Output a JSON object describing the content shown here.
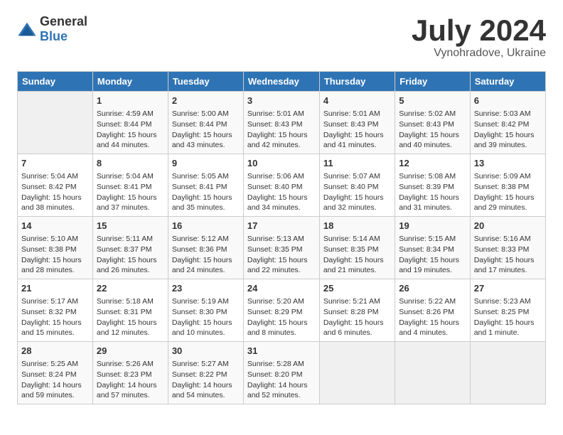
{
  "header": {
    "logo_general": "General",
    "logo_blue": "Blue",
    "title": "July 2024",
    "location": "Vynohradove, Ukraine"
  },
  "calendar": {
    "days_of_week": [
      "Sunday",
      "Monday",
      "Tuesday",
      "Wednesday",
      "Thursday",
      "Friday",
      "Saturday"
    ],
    "weeks": [
      [
        {
          "day": "",
          "info": ""
        },
        {
          "day": "1",
          "info": "Sunrise: 4:59 AM\nSunset: 8:44 PM\nDaylight: 15 hours\nand 44 minutes."
        },
        {
          "day": "2",
          "info": "Sunrise: 5:00 AM\nSunset: 8:44 PM\nDaylight: 15 hours\nand 43 minutes."
        },
        {
          "day": "3",
          "info": "Sunrise: 5:01 AM\nSunset: 8:43 PM\nDaylight: 15 hours\nand 42 minutes."
        },
        {
          "day": "4",
          "info": "Sunrise: 5:01 AM\nSunset: 8:43 PM\nDaylight: 15 hours\nand 41 minutes."
        },
        {
          "day": "5",
          "info": "Sunrise: 5:02 AM\nSunset: 8:43 PM\nDaylight: 15 hours\nand 40 minutes."
        },
        {
          "day": "6",
          "info": "Sunrise: 5:03 AM\nSunset: 8:42 PM\nDaylight: 15 hours\nand 39 minutes."
        }
      ],
      [
        {
          "day": "7",
          "info": "Sunrise: 5:04 AM\nSunset: 8:42 PM\nDaylight: 15 hours\nand 38 minutes."
        },
        {
          "day": "8",
          "info": "Sunrise: 5:04 AM\nSunset: 8:41 PM\nDaylight: 15 hours\nand 37 minutes."
        },
        {
          "day": "9",
          "info": "Sunrise: 5:05 AM\nSunset: 8:41 PM\nDaylight: 15 hours\nand 35 minutes."
        },
        {
          "day": "10",
          "info": "Sunrise: 5:06 AM\nSunset: 8:40 PM\nDaylight: 15 hours\nand 34 minutes."
        },
        {
          "day": "11",
          "info": "Sunrise: 5:07 AM\nSunset: 8:40 PM\nDaylight: 15 hours\nand 32 minutes."
        },
        {
          "day": "12",
          "info": "Sunrise: 5:08 AM\nSunset: 8:39 PM\nDaylight: 15 hours\nand 31 minutes."
        },
        {
          "day": "13",
          "info": "Sunrise: 5:09 AM\nSunset: 8:38 PM\nDaylight: 15 hours\nand 29 minutes."
        }
      ],
      [
        {
          "day": "14",
          "info": "Sunrise: 5:10 AM\nSunset: 8:38 PM\nDaylight: 15 hours\nand 28 minutes."
        },
        {
          "day": "15",
          "info": "Sunrise: 5:11 AM\nSunset: 8:37 PM\nDaylight: 15 hours\nand 26 minutes."
        },
        {
          "day": "16",
          "info": "Sunrise: 5:12 AM\nSunset: 8:36 PM\nDaylight: 15 hours\nand 24 minutes."
        },
        {
          "day": "17",
          "info": "Sunrise: 5:13 AM\nSunset: 8:35 PM\nDaylight: 15 hours\nand 22 minutes."
        },
        {
          "day": "18",
          "info": "Sunrise: 5:14 AM\nSunset: 8:35 PM\nDaylight: 15 hours\nand 21 minutes."
        },
        {
          "day": "19",
          "info": "Sunrise: 5:15 AM\nSunset: 8:34 PM\nDaylight: 15 hours\nand 19 minutes."
        },
        {
          "day": "20",
          "info": "Sunrise: 5:16 AM\nSunset: 8:33 PM\nDaylight: 15 hours\nand 17 minutes."
        }
      ],
      [
        {
          "day": "21",
          "info": "Sunrise: 5:17 AM\nSunset: 8:32 PM\nDaylight: 15 hours\nand 15 minutes."
        },
        {
          "day": "22",
          "info": "Sunrise: 5:18 AM\nSunset: 8:31 PM\nDaylight: 15 hours\nand 12 minutes."
        },
        {
          "day": "23",
          "info": "Sunrise: 5:19 AM\nSunset: 8:30 PM\nDaylight: 15 hours\nand 10 minutes."
        },
        {
          "day": "24",
          "info": "Sunrise: 5:20 AM\nSunset: 8:29 PM\nDaylight: 15 hours\nand 8 minutes."
        },
        {
          "day": "25",
          "info": "Sunrise: 5:21 AM\nSunset: 8:28 PM\nDaylight: 15 hours\nand 6 minutes."
        },
        {
          "day": "26",
          "info": "Sunrise: 5:22 AM\nSunset: 8:26 PM\nDaylight: 15 hours\nand 4 minutes."
        },
        {
          "day": "27",
          "info": "Sunrise: 5:23 AM\nSunset: 8:25 PM\nDaylight: 15 hours\nand 1 minute."
        }
      ],
      [
        {
          "day": "28",
          "info": "Sunrise: 5:25 AM\nSunset: 8:24 PM\nDaylight: 14 hours\nand 59 minutes."
        },
        {
          "day": "29",
          "info": "Sunrise: 5:26 AM\nSunset: 8:23 PM\nDaylight: 14 hours\nand 57 minutes."
        },
        {
          "day": "30",
          "info": "Sunrise: 5:27 AM\nSunset: 8:22 PM\nDaylight: 14 hours\nand 54 minutes."
        },
        {
          "day": "31",
          "info": "Sunrise: 5:28 AM\nSunset: 8:20 PM\nDaylight: 14 hours\nand 52 minutes."
        },
        {
          "day": "",
          "info": ""
        },
        {
          "day": "",
          "info": ""
        },
        {
          "day": "",
          "info": ""
        }
      ]
    ]
  }
}
